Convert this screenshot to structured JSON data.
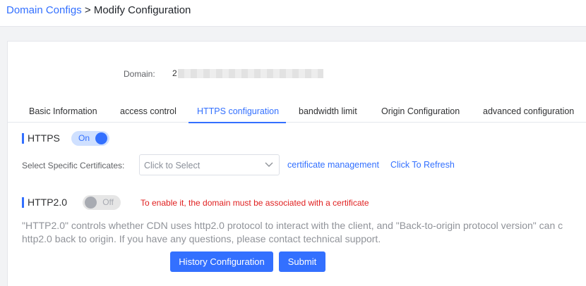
{
  "breadcrumb": {
    "parent": "Domain Configs",
    "separator": ">",
    "current": "Modify Configuration"
  },
  "domain": {
    "label": "Domain:",
    "value_visible": "2"
  },
  "tabs": [
    {
      "label": "Basic Information",
      "active": false
    },
    {
      "label": "access control",
      "active": false
    },
    {
      "label": "HTTPS configuration",
      "active": true
    },
    {
      "label": "bandwidth limit",
      "active": false
    },
    {
      "label": "Origin Configuration",
      "active": false
    },
    {
      "label": "advanced configuration",
      "active": false
    }
  ],
  "https": {
    "title": "HTTPS",
    "switch_text": "On",
    "enabled": true,
    "cert_label": "Select Specific Certificates:",
    "cert_placeholder": "Click to Select",
    "cert_management_link": "certificate management",
    "refresh_link": "Click To Refresh"
  },
  "http2": {
    "title": "HTTP2.0",
    "switch_text": "Off",
    "enabled": false,
    "warning": "To enable it, the domain must be associated with a certificate",
    "description_line1": "\"HTTP2.0\" controls whether CDN uses http2.0 protocol to interact with the client, and \"Back-to-origin protocol version\" can c",
    "description_line2": "http2.0 back to origin. If you have any questions, please contact technical support."
  },
  "actions": {
    "history_label": "History Configuration",
    "submit_label": "Submit"
  },
  "colors": {
    "accent": "#3370ff",
    "warning": "#e02020",
    "background": "#f2f3f5"
  }
}
